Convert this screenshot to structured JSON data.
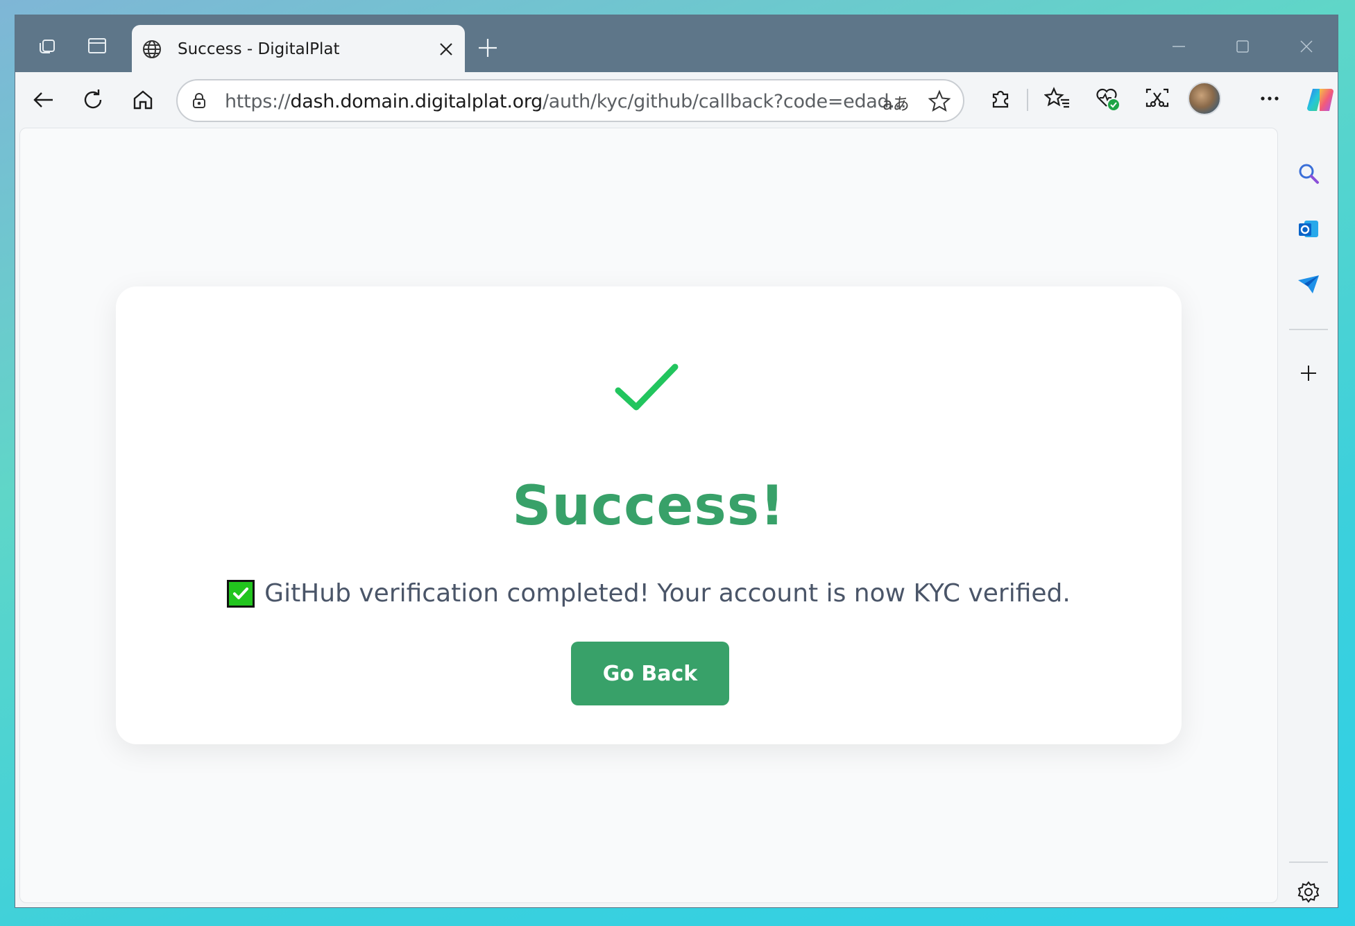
{
  "browser": {
    "tab": {
      "title": "Success - DigitalPlat"
    },
    "address": {
      "scheme": "https://",
      "host": "dash.domain.digitalplat.org",
      "path": "/auth/kyc/github/callback?code=edad...",
      "translate_glyph": "aあ"
    },
    "icons": {
      "workspaces": "workspaces-icon",
      "tab_actions": "tab-actions-icon",
      "site_info": "globe-icon",
      "close_tab": "close-icon",
      "new_tab": "plus-icon",
      "back": "back-arrow-icon",
      "refresh": "refresh-icon",
      "home": "home-icon",
      "lock": "lock-icon",
      "favorite": "star-icon",
      "extensions": "puzzle-icon",
      "favorites": "favorites-icon",
      "health": "heart-check-icon",
      "screenshot": "screenshot-icon",
      "more": "more-icon",
      "copilot": "copilot-icon"
    }
  },
  "page": {
    "headline": "Success!",
    "message": "GitHub verification completed! Your account is now KYC verified.",
    "button_label": "Go Back"
  },
  "colors": {
    "accent_green": "#38a169",
    "check_green": "#22c55e",
    "titlebar": "#5e7689"
  }
}
